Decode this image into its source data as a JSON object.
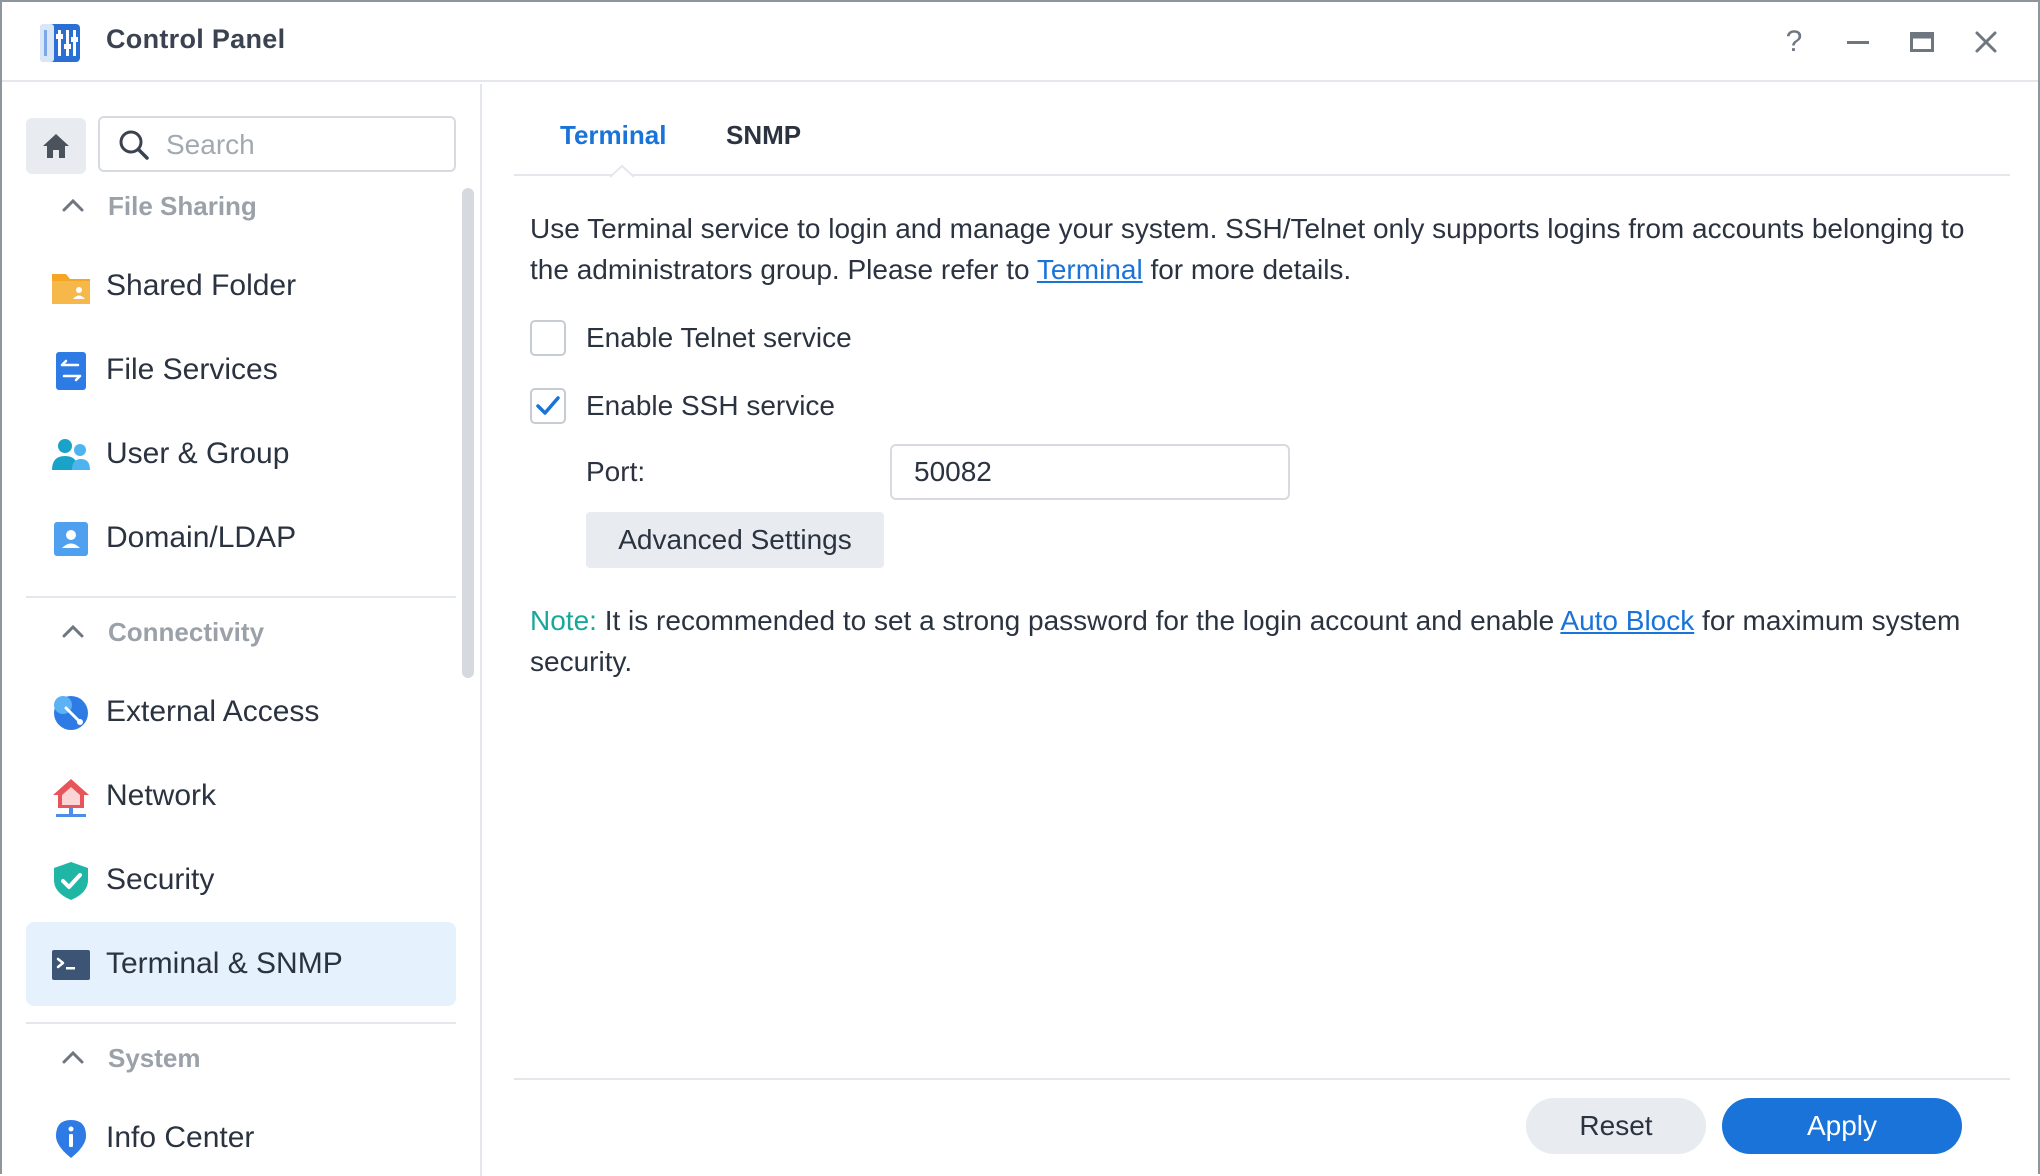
{
  "window": {
    "title": "Control Panel",
    "help_glyph": "?"
  },
  "sidebar": {
    "search_placeholder": "Search",
    "sections": [
      {
        "title": "File Sharing",
        "items": [
          {
            "label": "Shared Folder",
            "icon": "shared-folder-icon"
          },
          {
            "label": "File Services",
            "icon": "file-services-icon"
          },
          {
            "label": "User & Group",
            "icon": "user-group-icon"
          },
          {
            "label": "Domain/LDAP",
            "icon": "domain-ldap-icon"
          }
        ]
      },
      {
        "title": "Connectivity",
        "items": [
          {
            "label": "External Access",
            "icon": "external-access-icon"
          },
          {
            "label": "Network",
            "icon": "network-icon"
          },
          {
            "label": "Security",
            "icon": "security-shield-icon"
          },
          {
            "label": "Terminal & SNMP",
            "icon": "terminal-icon",
            "selected": true
          }
        ]
      },
      {
        "title": "System",
        "items": [
          {
            "label": "Info Center",
            "icon": "info-center-icon"
          }
        ]
      }
    ]
  },
  "main": {
    "tabs": [
      {
        "label": "Terminal",
        "active": true
      },
      {
        "label": "SNMP",
        "active": false
      }
    ],
    "description": {
      "before": "Use Terminal service to login and manage your system. SSH/Telnet only supports logins from accounts belonging to the administrators group. Please refer to ",
      "link": "Terminal",
      "after": " for more details."
    },
    "telnet": {
      "label": "Enable Telnet service",
      "checked": false
    },
    "ssh": {
      "label": "Enable SSH service",
      "checked": true
    },
    "port": {
      "label": "Port:",
      "value": "50082"
    },
    "advanced_button": "Advanced Settings",
    "note": {
      "label": "Note:",
      "before": " It is recommended to set a strong password for the login account and enable ",
      "link": "Auto Block",
      "after": " for maximum system security."
    },
    "reset_button": "Reset",
    "apply_button": "Apply"
  },
  "colors": {
    "accent": "#1a73d9",
    "note": "#18a89a",
    "selected_bg": "#e6f1fe"
  }
}
